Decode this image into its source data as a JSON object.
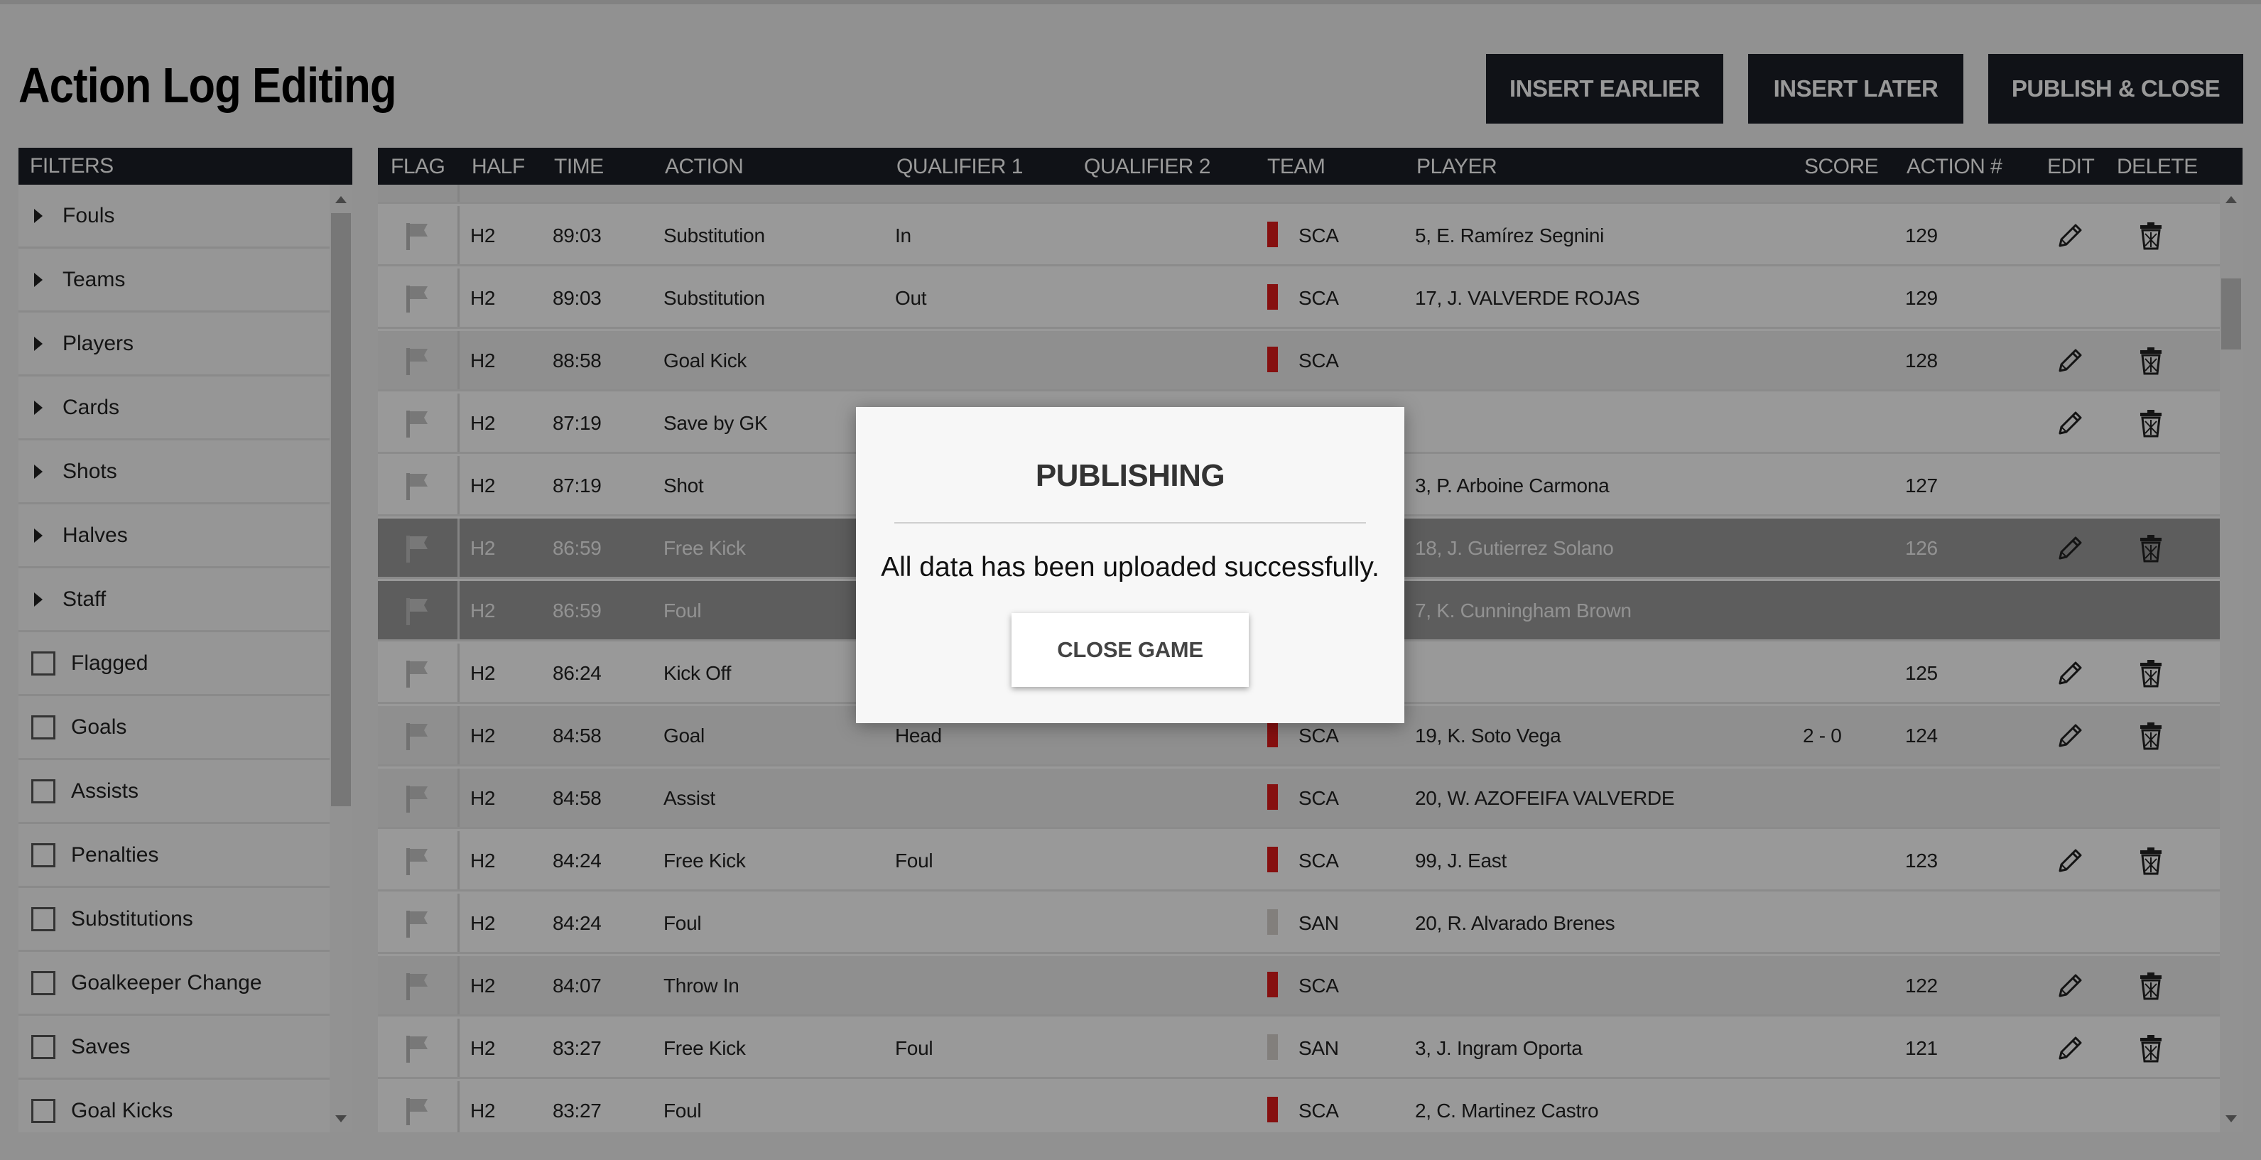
{
  "page": {
    "title": "Action Log Editing"
  },
  "toolbar": {
    "insert_earlier": "INSERT EARLIER",
    "insert_later": "INSERT LATER",
    "publish_close": "PUBLISH & CLOSE"
  },
  "filters": {
    "header": "FILTERS",
    "groups": [
      "Fouls",
      "Teams",
      "Players",
      "Cards",
      "Shots",
      "Halves",
      "Staff"
    ],
    "checks": [
      "Flagged",
      "Goals",
      "Assists",
      "Penalties",
      "Substitutions",
      "Goalkeeper Change",
      "Saves",
      "Goal Kicks"
    ]
  },
  "table": {
    "columns": {
      "flag": "FLAG",
      "half": "HALF",
      "time": "TIME",
      "action": "ACTION",
      "q1": "QUALIFIER 1",
      "q2": "QUALIFIER 2",
      "team": "TEAM",
      "player": "PLAYER",
      "score": "SCORE",
      "action_no": "ACTION #",
      "edit": "EDIT",
      "delete": "DELETE"
    },
    "rows": [
      {
        "half": "H2",
        "time": "89:03",
        "action": "Substitution",
        "q1": "In",
        "q2": "",
        "team": "SCA",
        "player": "5, E. Ramírez Segnini",
        "score": "",
        "no": "129",
        "edit": true,
        "del": true,
        "alt": false,
        "sel": false
      },
      {
        "half": "H2",
        "time": "89:03",
        "action": "Substitution",
        "q1": "Out",
        "q2": "",
        "team": "SCA",
        "player": "17, J. VALVERDE ROJAS",
        "score": "",
        "no": "129",
        "edit": false,
        "del": false,
        "alt": false,
        "sel": false
      },
      {
        "half": "H2",
        "time": "88:58",
        "action": "Goal Kick",
        "q1": "",
        "q2": "",
        "team": "SCA",
        "player": "",
        "score": "",
        "no": "128",
        "edit": true,
        "del": true,
        "alt": true,
        "sel": false
      },
      {
        "half": "H2",
        "time": "87:19",
        "action": "Save by GK",
        "q1": "",
        "q2": "",
        "team": "",
        "player": "",
        "score": "",
        "no": "",
        "edit": true,
        "del": true,
        "alt": false,
        "sel": false
      },
      {
        "half": "H2",
        "time": "87:19",
        "action": "Shot",
        "q1": "",
        "q2": "",
        "team": "",
        "player": "3, P. Arboine Carmona",
        "score": "",
        "no": "127",
        "edit": false,
        "del": false,
        "alt": false,
        "sel": false
      },
      {
        "half": "H2",
        "time": "86:59",
        "action": "Free Kick",
        "q1": "",
        "q2": "",
        "team": "",
        "player": "18, J. Gutierrez Solano",
        "score": "",
        "no": "126",
        "edit": true,
        "del": true,
        "alt": false,
        "sel": true
      },
      {
        "half": "H2",
        "time": "86:59",
        "action": "Foul",
        "q1": "",
        "q2": "",
        "team": "",
        "player": "7, K. Cunningham Brown",
        "score": "",
        "no": "",
        "edit": false,
        "del": false,
        "alt": false,
        "sel": true
      },
      {
        "half": "H2",
        "time": "86:24",
        "action": "Kick Off",
        "q1": "",
        "q2": "",
        "team": "",
        "player": "",
        "score": "",
        "no": "125",
        "edit": true,
        "del": true,
        "alt": false,
        "sel": false
      },
      {
        "half": "H2",
        "time": "84:58",
        "action": "Goal",
        "q1": "Head",
        "q2": "",
        "team": "SCA",
        "player": "19, K. Soto Vega",
        "score": "2 - 0",
        "no": "124",
        "edit": true,
        "del": true,
        "alt": true,
        "sel": false
      },
      {
        "half": "H2",
        "time": "84:58",
        "action": "Assist",
        "q1": "",
        "q2": "",
        "team": "SCA",
        "player": "20, W. AZOFEIFA VALVERDE",
        "score": "",
        "no": "",
        "edit": false,
        "del": false,
        "alt": true,
        "sel": false
      },
      {
        "half": "H2",
        "time": "84:24",
        "action": "Free Kick",
        "q1": "Foul",
        "q2": "",
        "team": "SCA",
        "player": "99, J. East",
        "score": "",
        "no": "123",
        "edit": true,
        "del": true,
        "alt": false,
        "sel": false
      },
      {
        "half": "H2",
        "time": "84:24",
        "action": "Foul",
        "q1": "",
        "q2": "",
        "team": "SAN",
        "player": "20, R. Alvarado Brenes",
        "score": "",
        "no": "",
        "edit": false,
        "del": false,
        "alt": false,
        "sel": false
      },
      {
        "half": "H2",
        "time": "84:07",
        "action": "Throw In",
        "q1": "",
        "q2": "",
        "team": "SCA",
        "player": "",
        "score": "",
        "no": "122",
        "edit": true,
        "del": true,
        "alt": true,
        "sel": false
      },
      {
        "half": "H2",
        "time": "83:27",
        "action": "Free Kick",
        "q1": "Foul",
        "q2": "",
        "team": "SAN",
        "player": "3, J. Ingram Oporta",
        "score": "",
        "no": "121",
        "edit": true,
        "del": true,
        "alt": false,
        "sel": false
      },
      {
        "half": "H2",
        "time": "83:27",
        "action": "Foul",
        "q1": "",
        "q2": "",
        "team": "SCA",
        "player": "2, C. Martinez Castro",
        "score": "",
        "no": "",
        "edit": false,
        "del": false,
        "alt": false,
        "sel": false
      }
    ]
  },
  "team_colors": {
    "SCA": "#e01b1b",
    "SAN": "#d9d4cf"
  },
  "modal": {
    "title": "PUBLISHING",
    "message": "All data has been uploaded successfully.",
    "button": "CLOSE GAME"
  },
  "icons": {
    "flag": "flag-icon",
    "edit": "pencil-icon",
    "delete": "trash-icon"
  }
}
